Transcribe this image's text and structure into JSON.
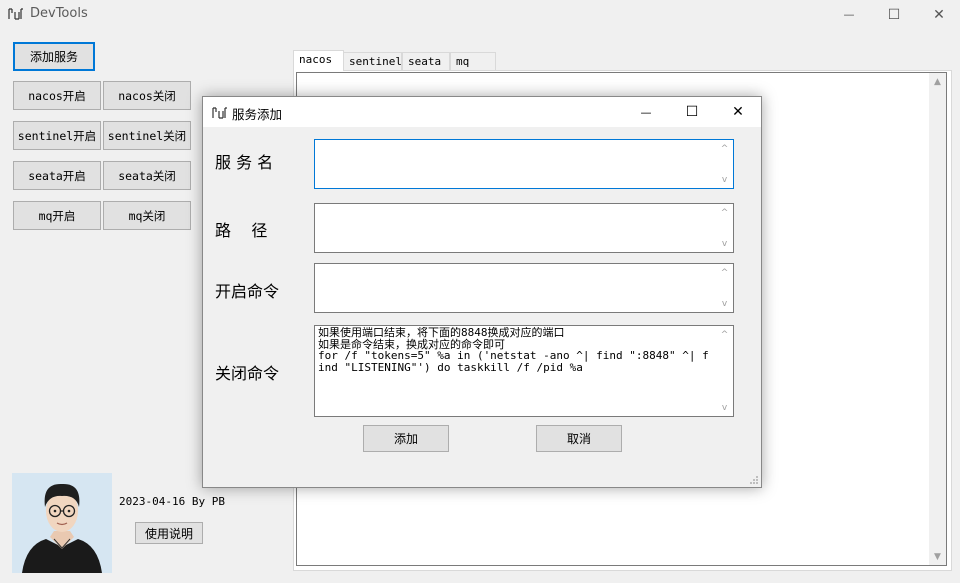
{
  "window": {
    "title": "DevTools",
    "controls": {
      "minimize": "—",
      "maximize": "☐",
      "close": "✕"
    }
  },
  "buttons": {
    "add_service": "添加服务",
    "nacos_on": "nacos开启",
    "nacos_off": "nacos关闭",
    "sentinel_on": "sentinel开启",
    "sentinel_off": "sentinel关闭",
    "seata_on": "seata开启",
    "seata_off": "seata关闭",
    "mq_on": "mq开启",
    "mq_off": "mq关闭",
    "help": "使用说明"
  },
  "tabs": [
    {
      "label": "nacos",
      "active": true
    },
    {
      "label": "sentinel",
      "active": false
    },
    {
      "label": "seata",
      "active": false
    },
    {
      "label": "mq",
      "active": false
    }
  ],
  "footer": {
    "signature": "2023-04-16 By PB"
  },
  "dialog": {
    "title": "服务添加",
    "controls": {
      "minimize": "—",
      "maximize": "☐",
      "close": "✕"
    },
    "fields": {
      "name": {
        "label": "服 务 名",
        "value": ""
      },
      "path": {
        "label": "路    径",
        "value": ""
      },
      "start_cmd": {
        "label": "开启命令",
        "value": ""
      },
      "stop_cmd": {
        "label": "关闭命令",
        "value": "如果使用端口结束，将下面的8848换成对应的端口\n如果是命令结束，换成对应的命令即可\nfor /f \"tokens=5\" %a in ('netstat -ano ^| find \":8848\" ^| find \"LISTENING\"') do taskkill /f /pid %a"
      }
    },
    "buttons": {
      "add": "添加",
      "cancel": "取消"
    }
  }
}
